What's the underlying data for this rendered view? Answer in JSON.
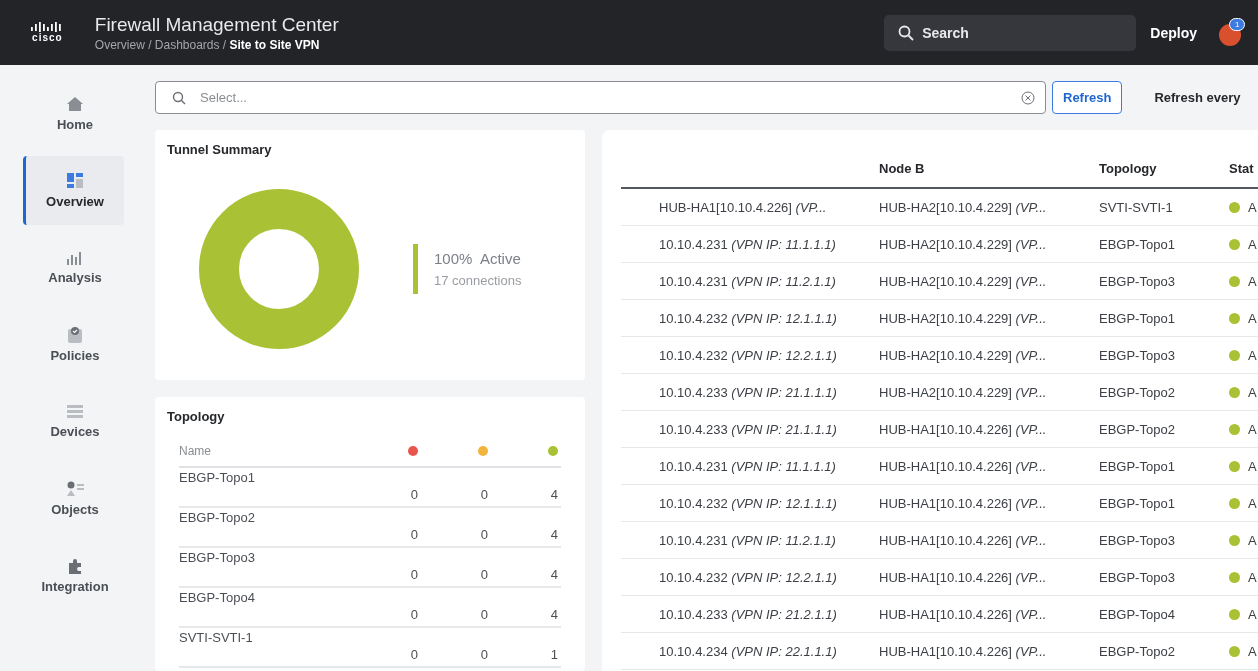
{
  "header": {
    "logo": "cisco",
    "title": "Firewall Management Center",
    "breadcrumb": "Overview / Dashboards / **Site to Site VPN**",
    "search": {
      "placeholder": "Search"
    },
    "deploy": "Deploy",
    "badge": "1"
  },
  "sidebar": {
    "items": [
      {
        "label": "Home",
        "selected": false
      },
      {
        "label": "Overview",
        "selected": true
      },
      {
        "label": "Analysis",
        "selected": false
      },
      {
        "label": "Policies",
        "selected": false
      },
      {
        "label": "Devices",
        "selected": false
      },
      {
        "label": "Objects",
        "selected": false
      },
      {
        "label": "Integration",
        "selected": false
      }
    ]
  },
  "filter": {
    "placeholder": "Select...",
    "refresh": "Refresh",
    "refresh_every": "Refresh every"
  },
  "tunnel_summary": {
    "title": "Tunnel Summary",
    "percent": "100%",
    "status": "Active",
    "connections": "17 connections",
    "color": "#a9c135"
  },
  "topology": {
    "title": "Topology",
    "columns": [
      {
        "kind": "name",
        "label": "Name"
      },
      {
        "kind": "status",
        "color": "#e8564b"
      },
      {
        "kind": "status",
        "color": "#f1b53d"
      },
      {
        "kind": "status",
        "color": "#a9c135"
      }
    ],
    "rows": [
      {
        "name": "EBGP-Topo1",
        "counts": [
          "0",
          "0",
          "4"
        ]
      },
      {
        "name": "EBGP-Topo2",
        "counts": [
          "0",
          "0",
          "4"
        ]
      },
      {
        "name": "EBGP-Topo3",
        "counts": [
          "0",
          "0",
          "4"
        ]
      },
      {
        "name": "EBGP-Topo4",
        "counts": [
          "0",
          "0",
          "4"
        ]
      },
      {
        "name": "SVTI-SVTI-1",
        "counts": [
          "0",
          "0",
          "1"
        ]
      }
    ]
  },
  "tunnels": {
    "columns": [
      "Node B",
      "Topology",
      "Stat"
    ],
    "rows": [
      {
        "node_a": "HUB-HA1[10.10.4.226] *(VP...*",
        "node_b": "HUB-HA2[10.10.4.229] *(VP...*",
        "topology": "SVTI-SVTI-1",
        "status": "A",
        "color": "#a9c135"
      },
      {
        "node_a": "10.10.4.231 *(VPN IP: 11.1.1.1)*",
        "node_b": "HUB-HA2[10.10.4.229] *(VP...*",
        "topology": "EBGP-Topo1",
        "status": "A",
        "color": "#a9c135"
      },
      {
        "node_a": "10.10.4.231 *(VPN IP: 11.2.1.1)*",
        "node_b": "HUB-HA2[10.10.4.229] *(VP...*",
        "topology": "EBGP-Topo3",
        "status": "A",
        "color": "#a9c135"
      },
      {
        "node_a": "10.10.4.232 *(VPN IP: 12.1.1.1)*",
        "node_b": "HUB-HA2[10.10.4.229] *(VP...*",
        "topology": "EBGP-Topo1",
        "status": "A",
        "color": "#a9c135"
      },
      {
        "node_a": "10.10.4.232 *(VPN IP: 12.2.1.1)*",
        "node_b": "HUB-HA2[10.10.4.229] *(VP...*",
        "topology": "EBGP-Topo3",
        "status": "A",
        "color": "#a9c135"
      },
      {
        "node_a": "10.10.4.233 *(VPN IP: 21.1.1.1)*",
        "node_b": "HUB-HA2[10.10.4.229] *(VP...*",
        "topology": "EBGP-Topo2",
        "status": "A",
        "color": "#a9c135"
      },
      {
        "node_a": "10.10.4.233 *(VPN IP: 21.1.1.1)*",
        "node_b": "HUB-HA1[10.10.4.226] *(VP...*",
        "topology": "EBGP-Topo2",
        "status": "A",
        "color": "#a9c135"
      },
      {
        "node_a": "10.10.4.231 *(VPN IP: 11.1.1.1)*",
        "node_b": "HUB-HA1[10.10.4.226] *(VP...*",
        "topology": "EBGP-Topo1",
        "status": "A",
        "color": "#a9c135"
      },
      {
        "node_a": "10.10.4.232 *(VPN IP: 12.1.1.1)*",
        "node_b": "HUB-HA1[10.10.4.226] *(VP...*",
        "topology": "EBGP-Topo1",
        "status": "A",
        "color": "#a9c135"
      },
      {
        "node_a": "10.10.4.231 *(VPN IP: 11.2.1.1)*",
        "node_b": "HUB-HA1[10.10.4.226] *(VP...*",
        "topology": "EBGP-Topo3",
        "status": "A",
        "color": "#a9c135"
      },
      {
        "node_a": "10.10.4.232 *(VPN IP: 12.2.1.1)*",
        "node_b": "HUB-HA1[10.10.4.226] *(VP...*",
        "topology": "EBGP-Topo3",
        "status": "A",
        "color": "#a9c135"
      },
      {
        "node_a": "10.10.4.233 *(VPN IP: 21.2.1.1)*",
        "node_b": "HUB-HA1[10.10.4.226] *(VP...*",
        "topology": "EBGP-Topo4",
        "status": "A",
        "color": "#a9c135"
      },
      {
        "node_a": "10.10.4.234 *(VPN IP: 22.1.1.1)*",
        "node_b": "HUB-HA1[10.10.4.226] *(VP...*",
        "topology": "EBGP-Topo2",
        "status": "A",
        "color": "#a9c135"
      }
    ]
  }
}
